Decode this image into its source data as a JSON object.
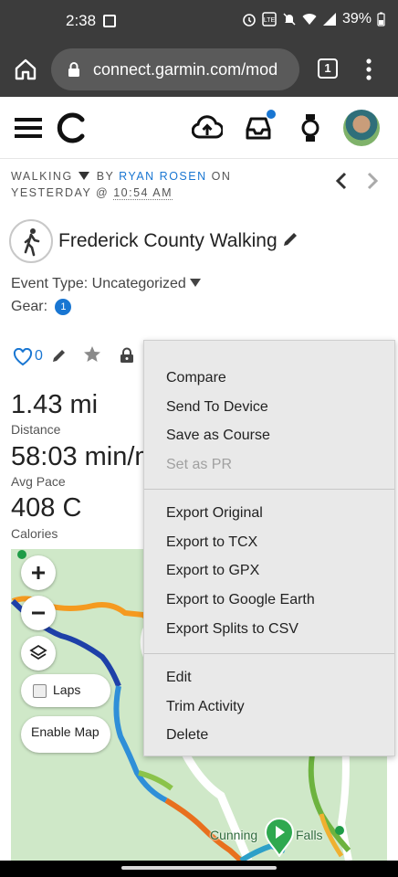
{
  "status_bar": {
    "time": "2:38",
    "battery": "39%"
  },
  "browser": {
    "url": "connect.garmin.com/mod",
    "tab_count": "1"
  },
  "activity": {
    "type": "WALKING",
    "by_label": "BY",
    "author": "RYAN ROSEN",
    "on_label": "ON YESTERDAY @",
    "time": "10:54 AM",
    "title": "Frederick County Walking",
    "event_type": "Event Type: Uncategorized",
    "gear_label": "Gear:",
    "gear_count": "1",
    "like_count": "0"
  },
  "stats": [
    {
      "value": "1.43 mi",
      "label": "Distance"
    },
    {
      "value": "58:03 min/mi",
      "label": "Avg Pace"
    },
    {
      "value": "408 C",
      "label": "Calories"
    }
  ],
  "map": {
    "laps_label": "Laps",
    "enable_map_label": "Enable Map",
    "place_label_left": "Cunning",
    "place_label_right": "Falls"
  },
  "dropdown": {
    "compare": "Compare",
    "send_to_device": "Send To Device",
    "save_as_course": "Save as Course",
    "set_as_pr": "Set as PR",
    "export_original": "Export Original",
    "export_tcx": "Export to TCX",
    "export_gpx": "Export to GPX",
    "export_google_earth": "Export to Google Earth",
    "export_splits_csv": "Export Splits to CSV",
    "edit": "Edit",
    "trim_activity": "Trim Activity",
    "delete": "Delete"
  },
  "colors": {
    "accent": "#1976d2",
    "status_bar": "#3c3c3c",
    "map_green": "#cfe8c8",
    "menu_bg": "#e9e9e9"
  }
}
